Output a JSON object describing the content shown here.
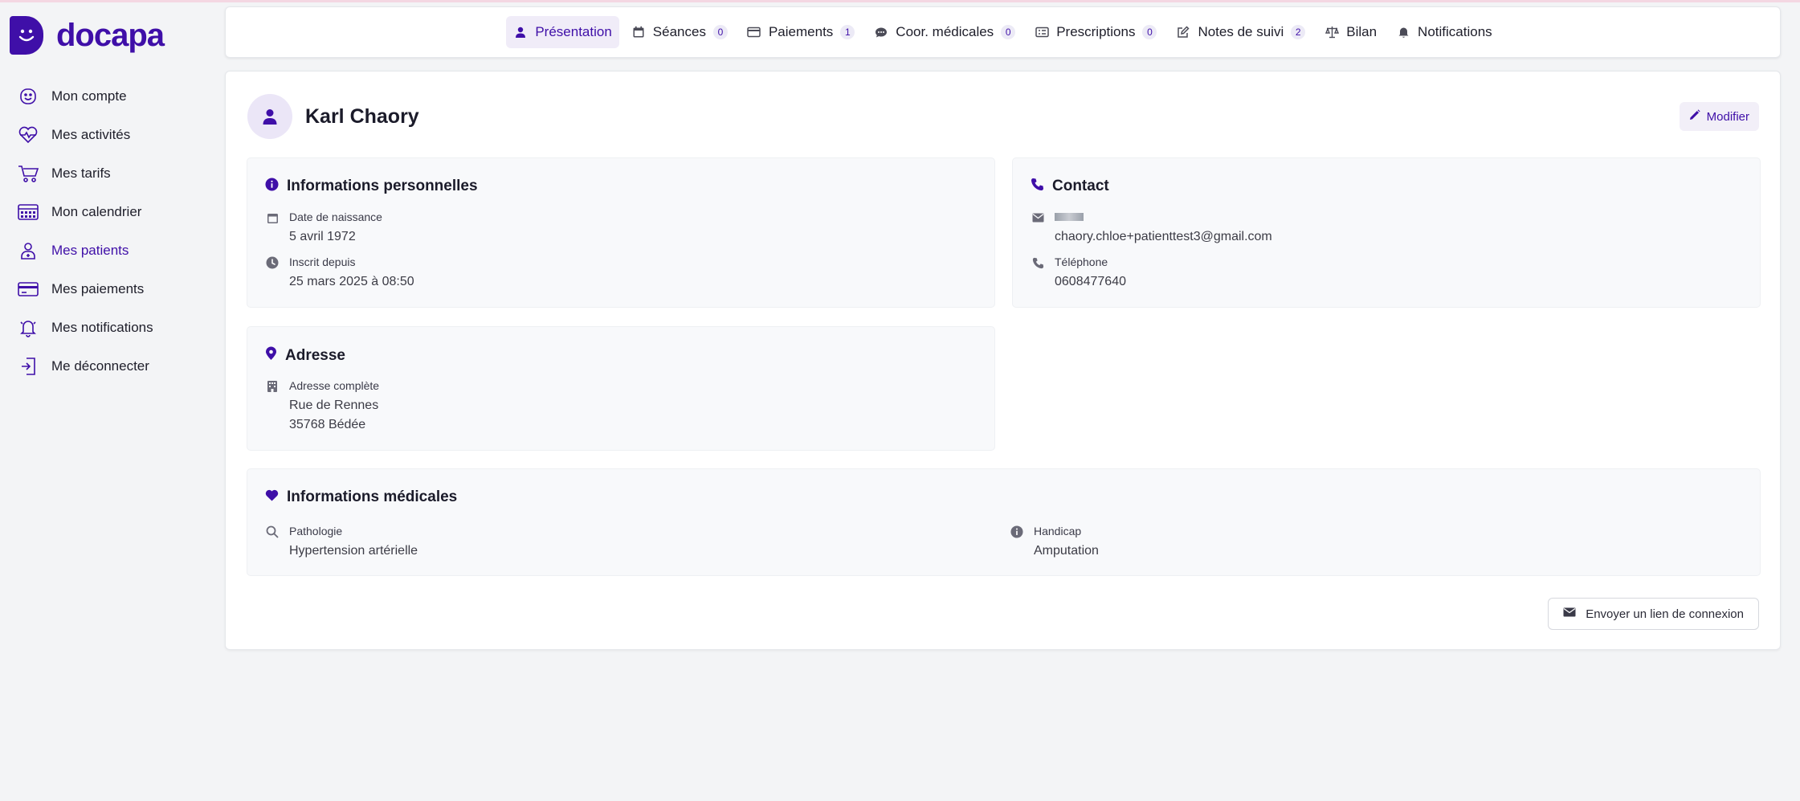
{
  "app": {
    "name": "docapa"
  },
  "colors": {
    "brand": "#3f0fa8",
    "background": "#f3f4f6",
    "panel": "#f8f9fb"
  },
  "sidebar": {
    "items": [
      {
        "label": "Mon compte",
        "icon": "smile-face-icon"
      },
      {
        "label": "Mes activités",
        "icon": "heart-pulse-icon"
      },
      {
        "label": "Mes tarifs",
        "icon": "cart-icon"
      },
      {
        "label": "Mon calendrier",
        "icon": "calendar-grid-icon"
      },
      {
        "label": "Mes patients",
        "icon": "patient-icon",
        "active": true
      },
      {
        "label": "Mes paiements",
        "icon": "card-icon"
      },
      {
        "label": "Mes notifications",
        "icon": "bell-icon"
      },
      {
        "label": "Me déconnecter",
        "icon": "logout-icon"
      }
    ]
  },
  "tabs": [
    {
      "label": "Présentation",
      "icon": "user-icon",
      "active": true
    },
    {
      "label": "Séances",
      "icon": "calendar-icon",
      "badge": "0"
    },
    {
      "label": "Paiements",
      "icon": "credit-card-icon",
      "badge": "1"
    },
    {
      "label": "Coor. médicales",
      "icon": "chat-icon",
      "badge": "0"
    },
    {
      "label": "Prescriptions",
      "icon": "list-icon",
      "badge": "0"
    },
    {
      "label": "Notes de suivi",
      "icon": "edit-icon",
      "badge": "2"
    },
    {
      "label": "Bilan",
      "icon": "scale-icon"
    },
    {
      "label": "Notifications",
      "icon": "bell-icon"
    }
  ],
  "patient": {
    "name": "Karl Chaory",
    "edit_label": "Modifier"
  },
  "personal": {
    "title": "Informations personnelles",
    "birth_label": "Date de naissance",
    "birth_value": "5 avril 1972",
    "registered_label": "Inscrit depuis",
    "registered_value": "25 mars 2025 à 08:50"
  },
  "contact": {
    "title": "Contact",
    "email_value": "chaory.chloe+patienttest3@gmail.com",
    "phone_label": "Téléphone",
    "phone_value": "0608477640"
  },
  "address": {
    "title": "Adresse",
    "label": "Adresse complète",
    "line1": "Rue de Rennes",
    "line2": "35768 Bédée"
  },
  "medical": {
    "title": "Informations médicales",
    "pathology_label": "Pathologie",
    "pathology_value": "Hypertension artérielle",
    "handicap_label": "Handicap",
    "handicap_value": "Amputation"
  },
  "actions": {
    "send_link_label": "Envoyer un lien de connexion"
  }
}
